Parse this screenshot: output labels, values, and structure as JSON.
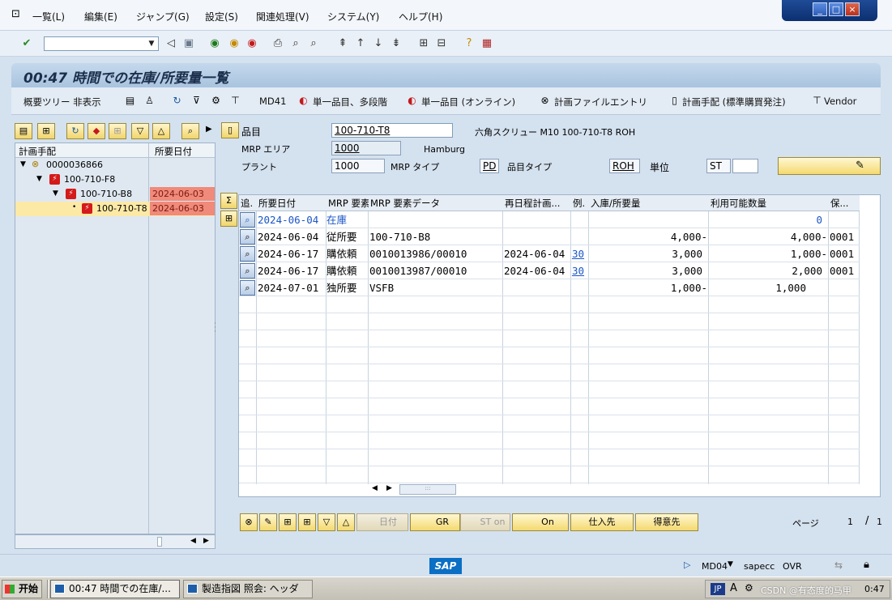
{
  "menu": {
    "items": [
      "一覧(L)",
      "編集(E)",
      "ジャンプ(G)",
      "設定(S)",
      "関連処理(V)",
      "システム(Y)",
      "ヘルプ(H)"
    ]
  },
  "title": "00:47 時間での在庫/所要量一覧",
  "app_toolbar": {
    "tree_toggle": "概要ツリー 非表示",
    "md41": "MD41",
    "single_multi": "単一品目、多段階",
    "single_online": "単一品目 (オンライン)",
    "plan_file": "計画ファイルエントリ",
    "planning_proc": "計画手配 (標準購買発注)",
    "vendor": "Vendor"
  },
  "tree": {
    "col_order": "計画手配",
    "col_date": "所要日付",
    "rows": [
      {
        "label": "0000036866",
        "date": ""
      },
      {
        "label": "100-710-F8",
        "date": ""
      },
      {
        "label": "100-710-B8",
        "date": "2024-06-03"
      },
      {
        "label": "100-710-T8",
        "date": "2024-06-03"
      }
    ]
  },
  "header": {
    "material_label": "品目",
    "material_value": "100-710-T8",
    "material_desc": "六角スクリュー M10 100-710-T8 ROH",
    "mrp_area_label": "MRP エリア",
    "mrp_area_value": "1000",
    "mrp_area_name": "Hamburg",
    "plant_label": "プラント",
    "plant_value": "1000",
    "mrp_type_label": "MRP タイプ",
    "mrp_type_value": "PD",
    "mat_type_label": "品目タイプ",
    "mat_type_value": "ROH",
    "unit_label": "単位",
    "unit_value": "ST"
  },
  "grid": {
    "headers": [
      "追.",
      "所要日付",
      "MRP 要素",
      "MRP 要素データ",
      "再日程計画...",
      "例.",
      "入庫/所要量",
      "利用可能数量",
      "保..."
    ],
    "rows": [
      {
        "date": "2024-06-04",
        "elem": "在庫",
        "data": "",
        "resched": "",
        "exc": "",
        "qty": "",
        "avail": "0",
        "stor": ""
      },
      {
        "date": "2024-06-04",
        "elem": "従所要",
        "data": "100-710-B8",
        "resched": "",
        "exc": "",
        "qty": "4,000-",
        "avail": "4,000-",
        "stor": "0001"
      },
      {
        "date": "2024-06-17",
        "elem": "購依頼",
        "data": "0010013986/00010",
        "resched": "2024-06-04",
        "exc": "30",
        "qty": "3,000",
        "avail": "1,000-",
        "stor": "0001"
      },
      {
        "date": "2024-06-17",
        "elem": "購依頼",
        "data": "0010013987/00010",
        "resched": "2024-06-04",
        "exc": "30",
        "qty": "3,000",
        "avail": "2,000",
        "stor": "0001"
      },
      {
        "date": "2024-07-01",
        "elem": "独所要",
        "data": "VSFB",
        "resched": "",
        "exc": "",
        "qty": "1,000-",
        "avail": "1,000",
        "stor": ""
      }
    ]
  },
  "bottom": {
    "date_btn": "日付",
    "gr_btn": "GR",
    "st_on_btn": "ST on",
    "on_btn": "On",
    "vendor_btn": "仕入先",
    "customer_btn": "得意先",
    "page_label": "ページ",
    "page_current": "1",
    "page_sep": "/",
    "page_total": "1"
  },
  "status": {
    "brand": "SAP",
    "tcode": "MD04",
    "server": "sapecc",
    "mode": "OVR"
  },
  "taskbar": {
    "start": "开始",
    "task1": "00:47 時間での在庫/...",
    "task2": "製造指図 照会: ヘッダ",
    "lang": "JP",
    "clock": "0:47",
    "watermark": "CSDN @有态度的马甲"
  },
  "colors": {
    "accent_red": "#f08a7a",
    "selected_row": "#fde9a6",
    "link_blue": "#1a55c7"
  }
}
